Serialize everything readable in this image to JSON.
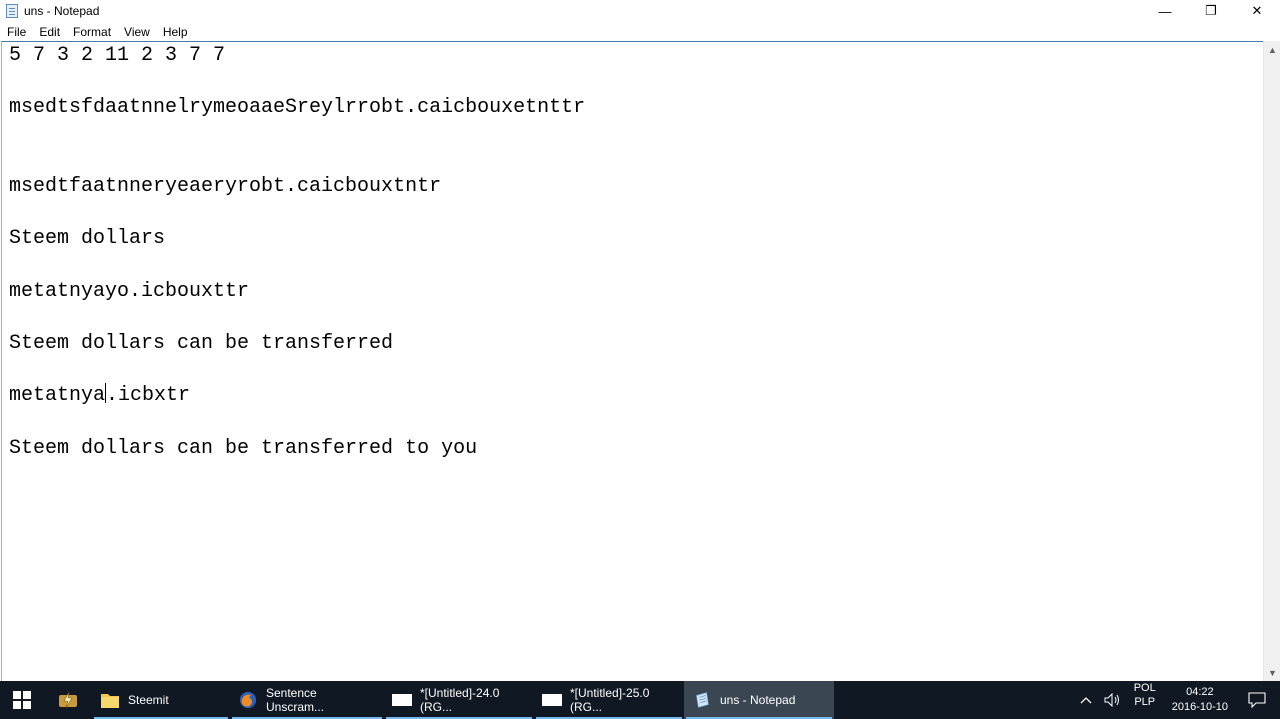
{
  "window": {
    "title": "uns - Notepad",
    "minimize": "—",
    "maximize": "❐",
    "close": "✕"
  },
  "menu": [
    "File",
    "Edit",
    "Format",
    "View",
    "Help"
  ],
  "editor": {
    "lines": [
      "5 7 3 2 11 2 3 7 7",
      "",
      "msedtsfdaatnnelrymeoaaeSreylrrobt.caicbouxetnttr",
      "",
      "",
      "msedtfaatnneryeaeryrobt.caicbouxtntr",
      "",
      "Steem dollars",
      "",
      "metatnyayo.icbouxttr",
      "",
      "Steem dollars can be transferred",
      "",
      "metatnya.icbxtr",
      "",
      "Steem dollars can be transferred to you"
    ],
    "caret_line": 13,
    "caret_before": "metatnya",
    "caret_after": ".icbxtr"
  },
  "taskbar": {
    "tasks": [
      {
        "label": "Steemit",
        "icon": "folder-icon"
      },
      {
        "label": "Sentence Unscram...",
        "icon": "firefox-icon"
      },
      {
        "label": "*[Untitled]-24.0 (RG...",
        "icon": "image-editor-icon"
      },
      {
        "label": "*[Untitled]-25.0 (RG...",
        "icon": "image-editor-icon"
      },
      {
        "label": "uns - Notepad",
        "icon": "notepad-icon"
      }
    ],
    "tray": {
      "lang_top": "POL",
      "lang_bottom": "PLP",
      "time": "04:22",
      "date": "2016-10-10"
    }
  },
  "colors": {
    "taskbar": "#101923",
    "active_task": "#3a4752",
    "accent": "#76b9ed"
  }
}
